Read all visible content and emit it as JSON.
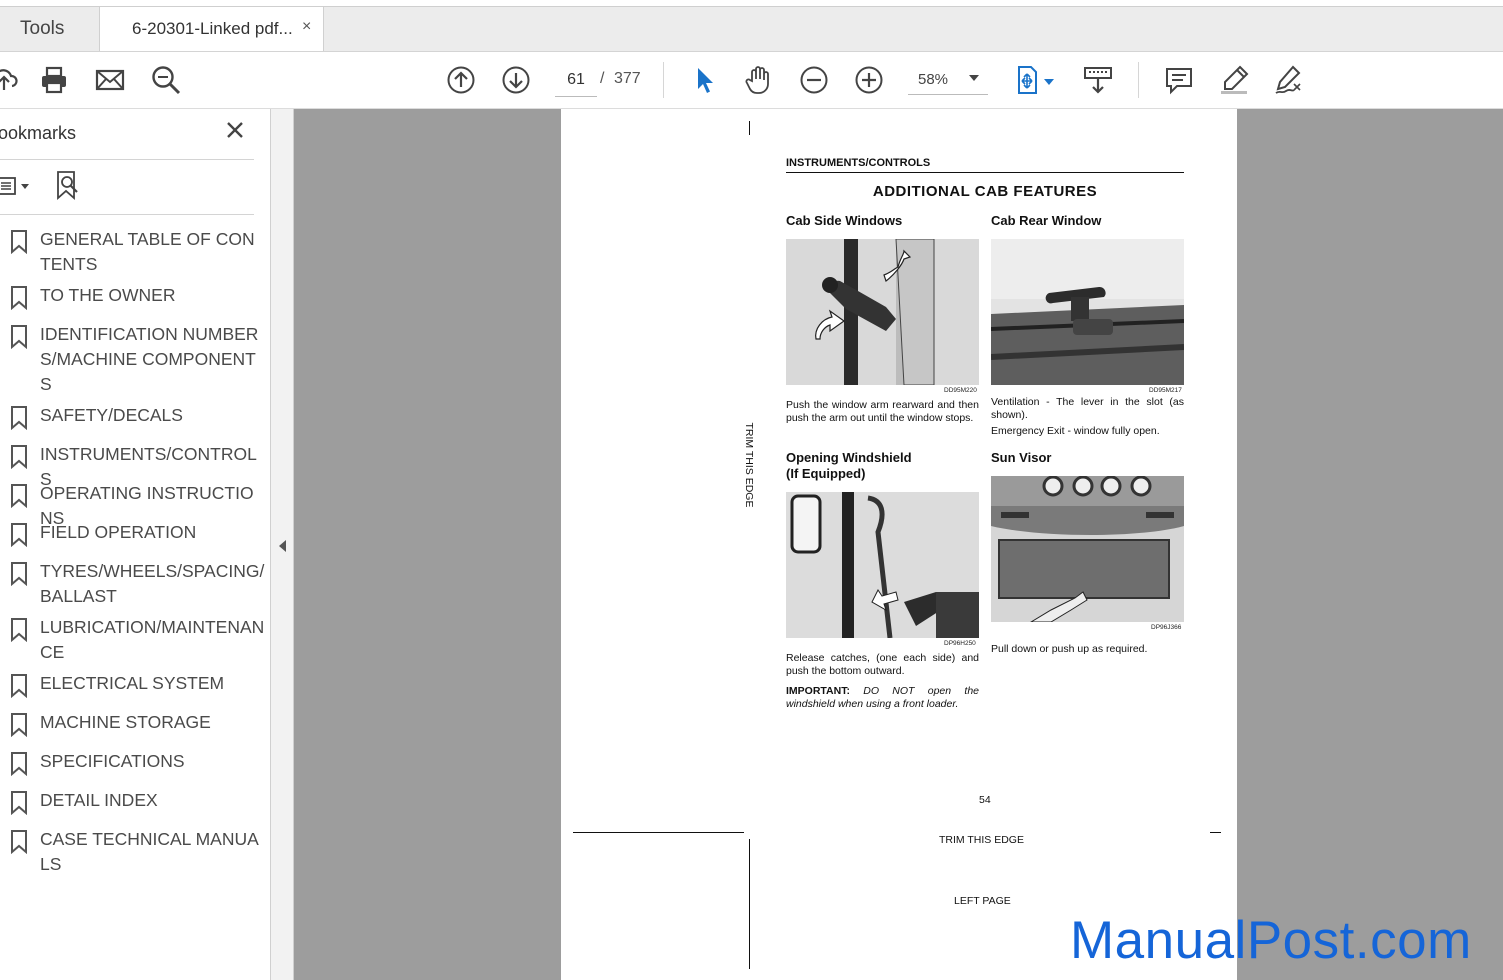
{
  "tabs": {
    "tools_label": "Tools",
    "doc_label": "6-20301-Linked pdf...",
    "close_glyph": "×"
  },
  "toolbar": {
    "current_page": "61",
    "page_separator": "/",
    "total_pages": "377",
    "zoom": "58%",
    "accent_color": "#1a73c9"
  },
  "sidebar": {
    "title": "ookmarks",
    "bookmarks": [
      {
        "label": "GENERAL TABLE OF CONTENTS"
      },
      {
        "label": "TO THE OWNER"
      },
      {
        "label": "IDENTIFICATION NUMBERS/MACHINE COMPONENTS"
      },
      {
        "label": "SAFETY/DECALS"
      },
      {
        "label": "INSTRUMENTS/CONTROLS"
      },
      {
        "label": "OPERATING INSTRUCTIONS"
      },
      {
        "label": "FIELD OPERATION"
      },
      {
        "label": "TYRES/WHEELS/SPACING/BALLAST"
      },
      {
        "label": "LUBRICATION/MAINTENANCE"
      },
      {
        "label": "ELECTRICAL SYSTEM"
      },
      {
        "label": "MACHINE STORAGE"
      },
      {
        "label": "SPECIFICATIONS"
      },
      {
        "label": "DETAIL INDEX"
      },
      {
        "label": "CASE TECHNICAL MANUALS"
      }
    ]
  },
  "document": {
    "section_header": "INSTRUMENTS/CONTROLS",
    "title": "ADDITIONAL CAB FEATURES",
    "trim_vertical": "TRIM THIS EDGE",
    "cab_side": {
      "heading": "Cab Side Windows",
      "fig_code": "DD95M220",
      "caption": "Push the window arm rearward and then push the arm out until the window stops."
    },
    "cab_rear": {
      "heading": "Cab Rear Window",
      "fig_code": "DD95M217",
      "caption1": "Ventilation - The lever in the slot (as shown).",
      "caption2": "Emergency Exit - window fully open."
    },
    "windshield": {
      "heading1": "Opening Windshield",
      "heading2": "(If Equipped)",
      "fig_code": "DP96H250",
      "caption": "Release catches, (one each side) and push the bottom outward.",
      "important_label": "IMPORTANT:",
      "important_text": "DO NOT open the windshield when using a front loader."
    },
    "sun_visor": {
      "heading": "Sun Visor",
      "fig_code": "DP96J366",
      "caption": "Pull down or push up as required."
    },
    "page_number": "54",
    "trim_bottom": "TRIM THIS EDGE",
    "left_page": "LEFT PAGE"
  },
  "watermark": "ManualPost.com"
}
